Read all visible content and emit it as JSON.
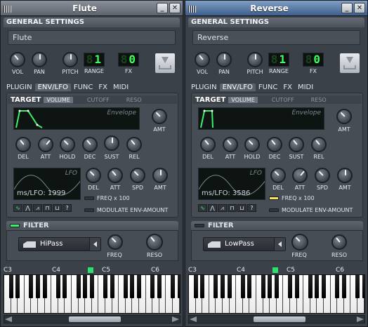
{
  "windows": [
    {
      "title": "Flute",
      "active": false,
      "general_settings": {
        "heading": "GENERAL SETTINGS",
        "name": "Flute",
        "knobs": [
          "VOL",
          "PAN",
          "PITCH"
        ],
        "range_label": "RANGE",
        "range_value": "1",
        "fx_label": "FX",
        "fx_value": "0"
      },
      "tabs": [
        "PLUGIN",
        "ENV/LFO",
        "FUNC",
        "FX",
        "MIDI"
      ],
      "selected_tab": "ENV/LFO",
      "target": {
        "heading": "TARGET",
        "subtabs": [
          "VOLUME",
          "CUTOFF",
          "RESO"
        ],
        "envelope_label": "Envelope",
        "amt_label": "AMT",
        "env_knobs": [
          "DEL",
          "ATT",
          "HOLD",
          "DEC",
          "SUST",
          "REL"
        ],
        "lfo_label": "LFO",
        "lfo_ms_label": "ms/LFO:",
        "lfo_ms_value": "1999",
        "lfo_knobs": [
          "DEL",
          "ATT",
          "SPD",
          "AMT"
        ],
        "freq_x100_label": "FREQ x 100",
        "freq_x100_on": false,
        "modulate_label": "MODULATE ENV-AMOUNT",
        "modulate_on": false,
        "wave_buttons": [
          "sine-wave-icon",
          "triangle-wave-icon",
          "saw-wave-icon",
          "square-wave-icon",
          "user-wave-icon",
          "question-icon"
        ]
      },
      "filter": {
        "heading": "FILTER",
        "enabled": true,
        "type": "HiPass",
        "knobs": [
          "FREQ",
          "RESO"
        ]
      },
      "piano": {
        "notes": [
          "C3",
          "C4",
          "C5",
          "C6"
        ]
      }
    },
    {
      "title": "Reverse",
      "active": true,
      "general_settings": {
        "heading": "GENERAL SETTINGS",
        "name": "Reverse",
        "knobs": [
          "VOL",
          "PAN",
          "PITCH"
        ],
        "range_label": "RANGE",
        "range_value": "1",
        "fx_label": "FX",
        "fx_value": "0"
      },
      "tabs": [
        "PLUGIN",
        "ENV/LFO",
        "FUNC",
        "FX",
        "MIDI"
      ],
      "selected_tab": "ENV/LFO",
      "target": {
        "heading": "TARGET",
        "subtabs": [
          "VOLUME",
          "CUTOFF",
          "RESO"
        ],
        "envelope_label": "Envelope",
        "amt_label": "AMT",
        "env_knobs": [
          "DEL",
          "ATT",
          "HOLD",
          "DEC",
          "SUST",
          "REL"
        ],
        "lfo_label": "LFO",
        "lfo_ms_label": "ms/LFO:",
        "lfo_ms_value": "3586",
        "lfo_knobs": [
          "DEL",
          "ATT",
          "SPD",
          "AMT"
        ],
        "freq_x100_label": "FREQ x 100",
        "freq_x100_on": true,
        "modulate_label": "MODULATE ENV-AMOUNT",
        "modulate_on": false,
        "wave_buttons": [
          "sine-wave-icon",
          "triangle-wave-icon",
          "saw-wave-icon",
          "square-wave-icon",
          "user-wave-icon",
          "question-icon"
        ]
      },
      "filter": {
        "heading": "FILTER",
        "enabled": false,
        "type": "LowPass",
        "knobs": [
          "FREQ",
          "RESO"
        ]
      },
      "piano": {
        "notes": [
          "C3",
          "C4",
          "C5",
          "C6"
        ]
      }
    }
  ],
  "colors": {
    "led_green": "#3cf06c",
    "led_yellow": "#f6e35a",
    "lcd_green": "#3dff5a",
    "active_titlebar": "#3e5f8c"
  }
}
